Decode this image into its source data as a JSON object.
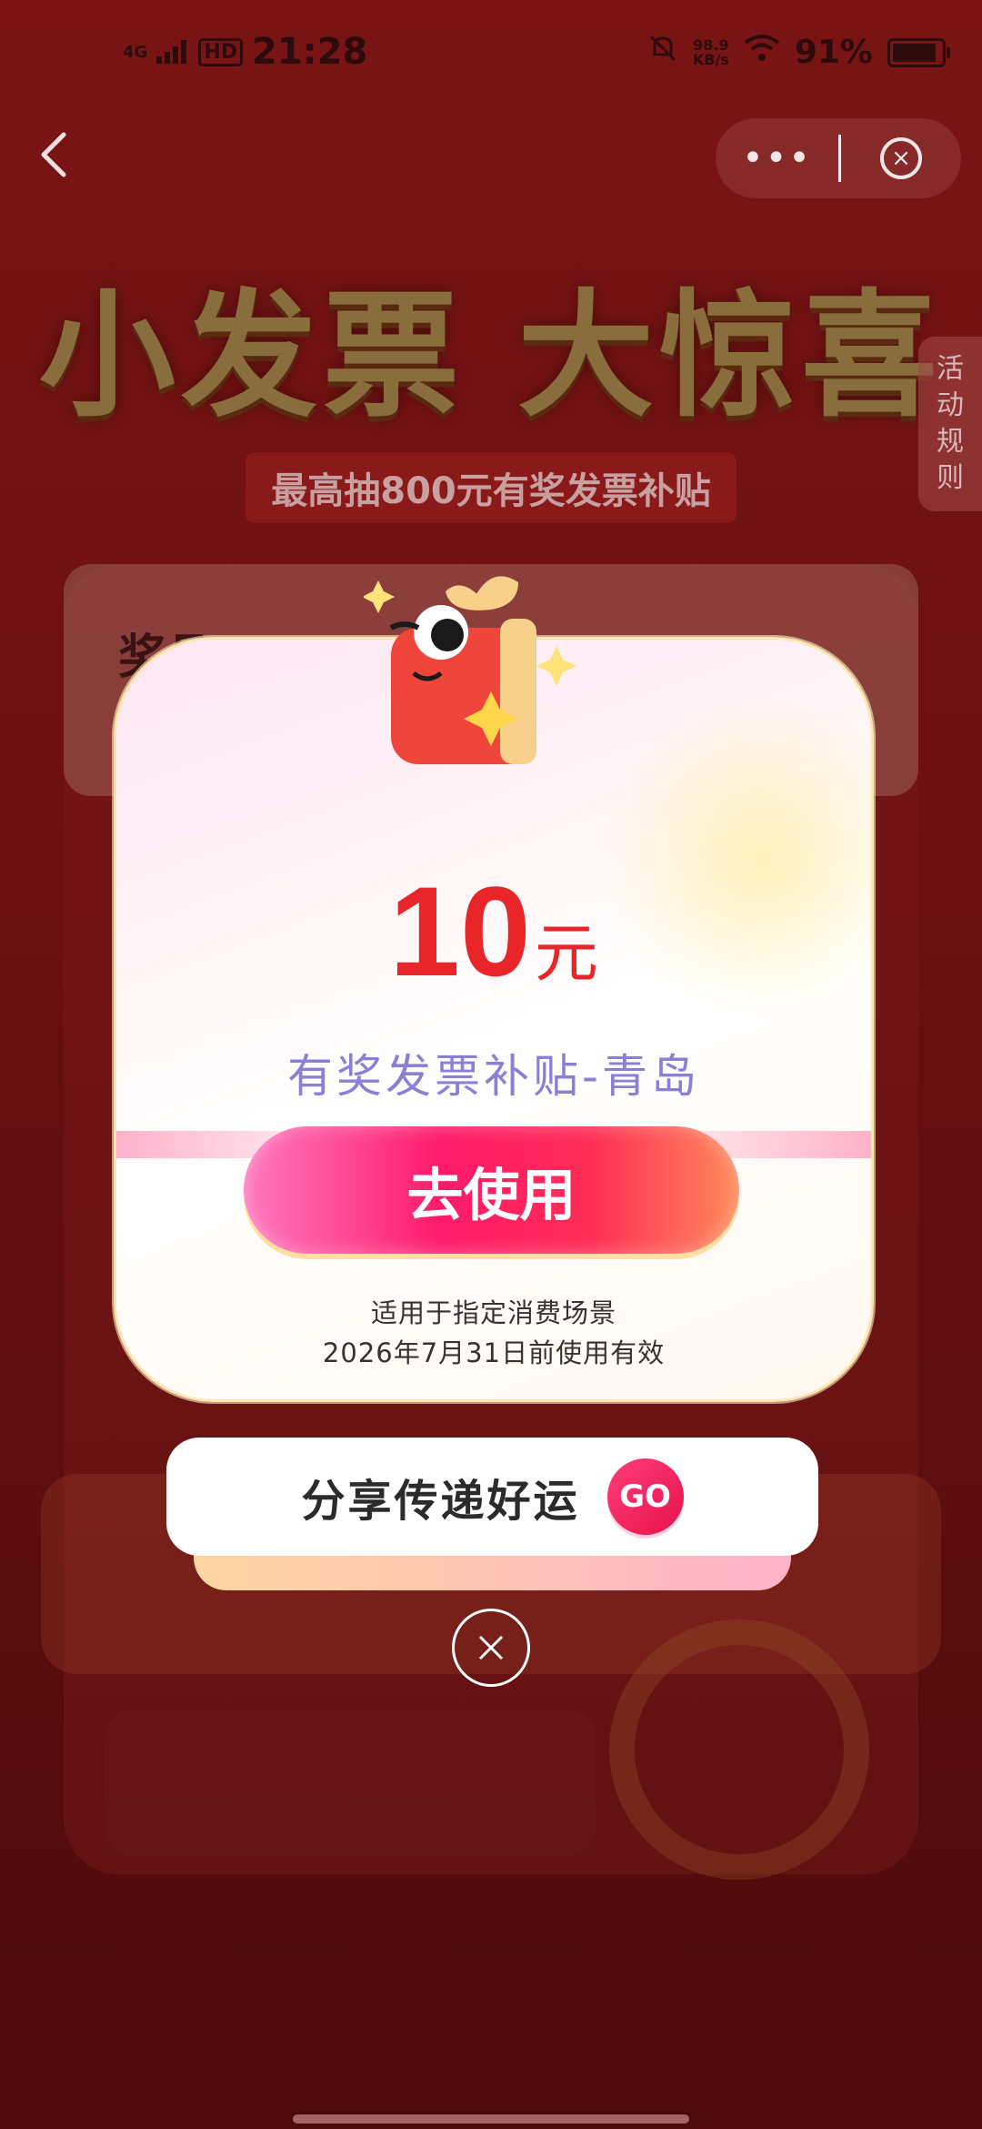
{
  "status_bar": {
    "network": "4G",
    "hd": "HD",
    "time": "21:28",
    "speed_value": "98.9",
    "speed_unit": "KB/s",
    "battery": "91%",
    "battery_level": 0.91
  },
  "nav": {
    "more": "•••",
    "close": "×"
  },
  "banner": {
    "title": "小发票 大惊喜",
    "subtitle": "最高抽800元有奖发票补贴"
  },
  "rules_tab": "活动规则",
  "background": {
    "card_label": "奖品"
  },
  "modal": {
    "amount": "10",
    "unit": "元",
    "coupon_name": "有奖发票补贴-青岛",
    "use_button": "去使用",
    "terms_line1": "适用于指定消费场景",
    "terms_line2": "2026年7月31日前使用有效"
  },
  "share": {
    "label": "分享传递好运",
    "go": "GO"
  },
  "colors": {
    "accent": "#e8262a",
    "coupon_text": "#8b7fd6",
    "button_pink": "#ff1a6a"
  }
}
